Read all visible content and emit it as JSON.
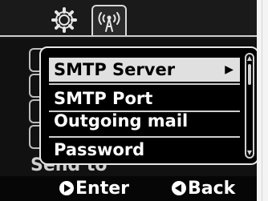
{
  "tabs": [
    {
      "icon": "gear-icon",
      "selected": false
    },
    {
      "icon": "wireless-antenna-icon",
      "selected": true
    }
  ],
  "background_menu": {
    "visible_partial_text": "Send to"
  },
  "popup_menu": {
    "items": [
      {
        "label": "SMTP Server",
        "selected": true,
        "has_submenu": true
      },
      {
        "label": "SMTP Port",
        "selected": false,
        "has_submenu": false
      },
      {
        "label": "Outgoing mail",
        "selected": false,
        "has_submenu": false
      },
      {
        "label": "Password",
        "selected": false,
        "has_submenu": false
      }
    ]
  },
  "footer": {
    "enter_label": "Enter",
    "back_label": "Back"
  },
  "colors": {
    "background": "#0a0a0a",
    "highlight": "#e0e0e0",
    "text": "#ffffff"
  }
}
